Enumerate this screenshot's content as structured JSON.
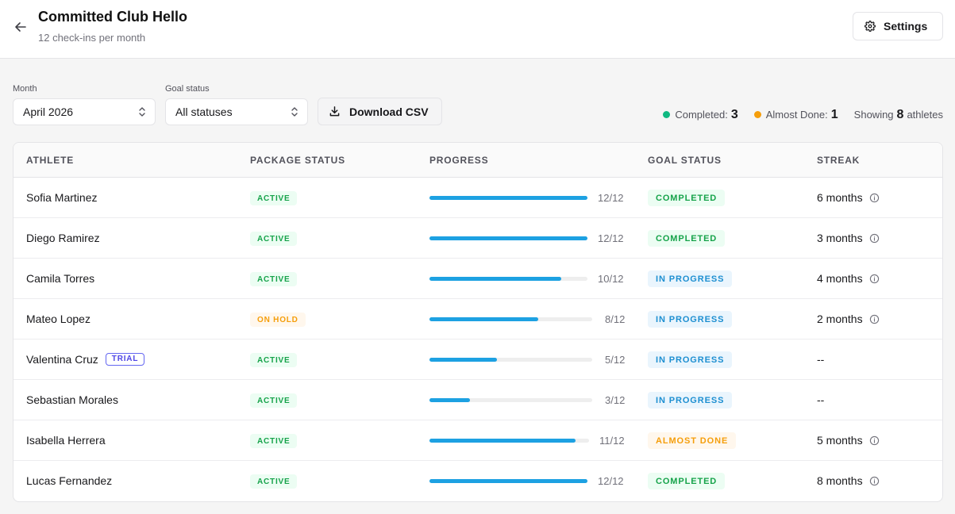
{
  "header": {
    "title": "Committed Club Hello",
    "subtitle": "12 check-ins per month",
    "settings_label": "Settings"
  },
  "filters": {
    "month_label": "Month",
    "month_value": "April 2026",
    "goal_label": "Goal status",
    "goal_value": "All statuses",
    "download_label": "Download CSV"
  },
  "summary": {
    "completed_label": "Completed:",
    "completed_count": "3",
    "almost_label": "Almost Done:",
    "almost_count": "1",
    "showing_label": "Showing",
    "showing_count": "8",
    "athletes_label": "athletes"
  },
  "colors": {
    "completed_dot": "#10b981",
    "almost_dot": "#f59e0b",
    "progress_bar": "#1da1e2"
  },
  "table": {
    "columns": [
      "ATHLETE",
      "PACKAGE STATUS",
      "PROGRESS",
      "GOAL STATUS",
      "STREAK"
    ],
    "rows": [
      {
        "athlete": "Sofia Martinez",
        "trial": "",
        "package": "ACTIVE",
        "progress": "12/12",
        "fraction": 1.0,
        "goal": "COMPLETED",
        "streak": "6 months",
        "has_info": true
      },
      {
        "athlete": "Diego Ramirez",
        "trial": "",
        "package": "ACTIVE",
        "progress": "12/12",
        "fraction": 1.0,
        "goal": "COMPLETED",
        "streak": "3 months",
        "has_info": true
      },
      {
        "athlete": "Camila Torres",
        "trial": "",
        "package": "ACTIVE",
        "progress": "10/12",
        "fraction": 0.833,
        "goal": "IN PROGRESS",
        "streak": "4 months",
        "has_info": true
      },
      {
        "athlete": "Mateo Lopez",
        "trial": "",
        "package": "ON HOLD",
        "progress": "8/12",
        "fraction": 0.667,
        "goal": "IN PROGRESS",
        "streak": "2 months",
        "has_info": true
      },
      {
        "athlete": "Valentina Cruz",
        "trial": "TRIAL",
        "package": "ACTIVE",
        "progress": "5/12",
        "fraction": 0.417,
        "goal": "IN PROGRESS",
        "streak": "--",
        "has_info": false
      },
      {
        "athlete": "Sebastian Morales",
        "trial": "",
        "package": "ACTIVE",
        "progress": "3/12",
        "fraction": 0.25,
        "goal": "IN PROGRESS",
        "streak": "--",
        "has_info": false
      },
      {
        "athlete": "Isabella Herrera",
        "trial": "",
        "package": "ACTIVE",
        "progress": "11/12",
        "fraction": 0.917,
        "goal": "ALMOST DONE",
        "streak": "5 months",
        "has_info": true
      },
      {
        "athlete": "Lucas Fernandez",
        "trial": "",
        "package": "ACTIVE",
        "progress": "12/12",
        "fraction": 1.0,
        "goal": "COMPLETED",
        "streak": "8 months",
        "has_info": true
      }
    ]
  }
}
